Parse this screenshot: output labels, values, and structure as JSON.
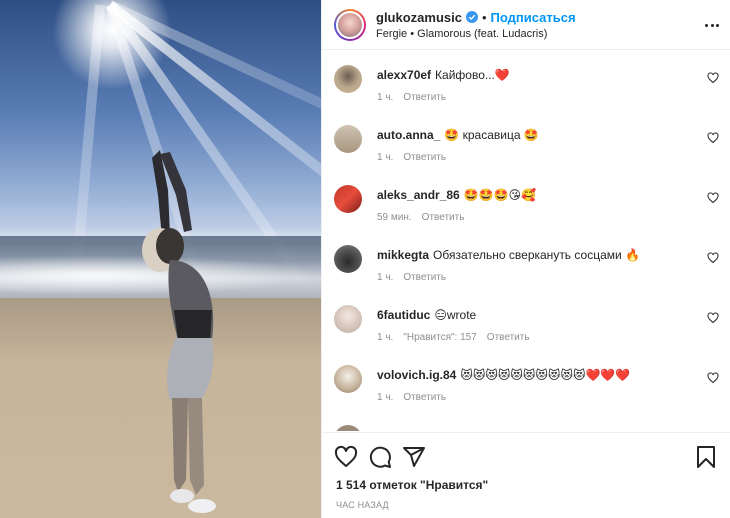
{
  "post": {
    "username": "glukozamusic",
    "follow_label": "Подписаться",
    "separator": "•",
    "music": "Fergie • Glamorous (feat. Ludacris)"
  },
  "comments": [
    {
      "user": "alexx70ef",
      "text": "Кайфово...❤️",
      "time": "1 ч.",
      "reply": "Ответить",
      "likes": ""
    },
    {
      "user": "auto.anna_",
      "text": "🤩 красавица 🤩",
      "time": "1 ч.",
      "reply": "Ответить",
      "likes": ""
    },
    {
      "user": "aleks_andr_86",
      "text": "🤩🤩🤩😘🥰",
      "time": "59 мин.",
      "reply": "Ответить",
      "likes": ""
    },
    {
      "user": "mikkegta",
      "text": "Обязательно сверкануть сосцами 🔥",
      "time": "1 ч.",
      "reply": "Ответить",
      "likes": ""
    },
    {
      "user": "6fautiduc",
      "text": "😑wrote",
      "time": "1 ч.",
      "reply": "Ответить",
      "likes": "\"Нравится\": 157"
    },
    {
      "user": "volovich.ig.84",
      "text": "😻😻😻😻😻😻😻😻😻😻❤️❤️❤️",
      "time": "1 ч.",
      "reply": "Ответить",
      "likes": ""
    }
  ],
  "footer": {
    "likes_count": "1 514 отметок \"Нравится\"",
    "timestamp": "ЧАС НАЗАД"
  },
  "icons": {
    "verified": "verified-icon",
    "more": "more-options-icon",
    "like": "heart-icon",
    "comment": "comment-icon",
    "share": "share-icon",
    "save": "bookmark-icon"
  },
  "colors": {
    "accent": "#0095f6",
    "muted": "#8e8e8e",
    "text": "#262626"
  }
}
